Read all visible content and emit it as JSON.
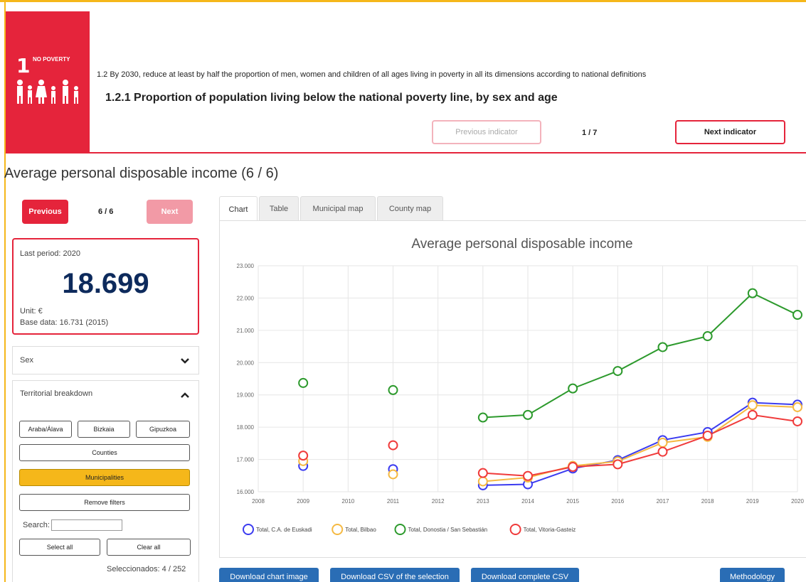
{
  "banner": {
    "goal_number": "1",
    "goal_name": "NO POVERTY",
    "target": "1.2 By 2030, reduce at least by half the proportion of men, women and children of all ages living in poverty in all its dimensions according to national definitions",
    "indicator": "1.2.1 Proportion of population living below the national poverty line, by sex and age",
    "prev_label": "Previous indicator",
    "next_label": "Next indicator",
    "pager": "1 / 7",
    "accent_color": "#e5243b",
    "border_color": "#f5b71a"
  },
  "section_title": "Average personal disposable income (6 / 6)",
  "sidebar": {
    "prev_label": "Previous",
    "next_label": "Next",
    "pager": "6 / 6",
    "stat": {
      "period": "Last period: 2020",
      "value": "18.699",
      "unit": "Unit: €",
      "base": "Base data: 16.731 (2015)"
    },
    "sex_label": "Sex",
    "territorial_label": "Territorial breakdown",
    "territories": [
      "Araba/Álava",
      "Bizkaia",
      "Gipuzkoa"
    ],
    "counties_label": "Counties",
    "municipalities_label": "Municipalities",
    "remove_filters_label": "Remove filters",
    "search_label": "Search:",
    "search_value": "",
    "select_all_label": "Select all",
    "clear_all_label": "Clear all",
    "selected_count": "Seleccionados: 4 / 252"
  },
  "tabs": [
    "Chart",
    "Table",
    "Municipal map",
    "County map"
  ],
  "active_tab": "Chart",
  "buttons": {
    "download_image": "Download chart image",
    "download_csv_selection": "Download CSV of the selection",
    "download_csv_complete": "Download complete CSV",
    "methodology": "Methodology"
  },
  "chart_data": {
    "type": "line",
    "title": "Average personal disposable income",
    "x": [
      2008,
      2009,
      2010,
      2011,
      2012,
      2013,
      2014,
      2015,
      2016,
      2017,
      2018,
      2019,
      2020
    ],
    "ylim": [
      16000,
      23000
    ],
    "yticks": [
      "16.000",
      "17.000",
      "18.000",
      "19.000",
      "20.000",
      "21.000",
      "22.000",
      "23.000"
    ],
    "grid": true,
    "legend_position": "bottom-left",
    "series": [
      {
        "name": "Total, C.A. de Euskadi",
        "color": "#3b3bf0",
        "values": [
          null,
          16800,
          null,
          16700,
          null,
          16200,
          16230,
          16720,
          16980,
          17600,
          17850,
          18760,
          18699
        ]
      },
      {
        "name": "Total, Bilbao",
        "color": "#f5b942",
        "values": [
          null,
          16950,
          null,
          16540,
          null,
          16320,
          16440,
          16800,
          16940,
          17520,
          17700,
          18680,
          18620
        ]
      },
      {
        "name": "Total, Donostia / San Sebastián",
        "color": "#2d9a2d",
        "values": [
          null,
          19370,
          null,
          19150,
          null,
          18300,
          18380,
          19200,
          19740,
          20480,
          20820,
          22150,
          21480
        ]
      },
      {
        "name": "Total, Vitoria-Gasteiz",
        "color": "#f03b3b",
        "values": [
          null,
          17120,
          null,
          17440,
          null,
          16580,
          16490,
          16770,
          16850,
          17240,
          17740,
          18380,
          18180
        ]
      }
    ]
  }
}
